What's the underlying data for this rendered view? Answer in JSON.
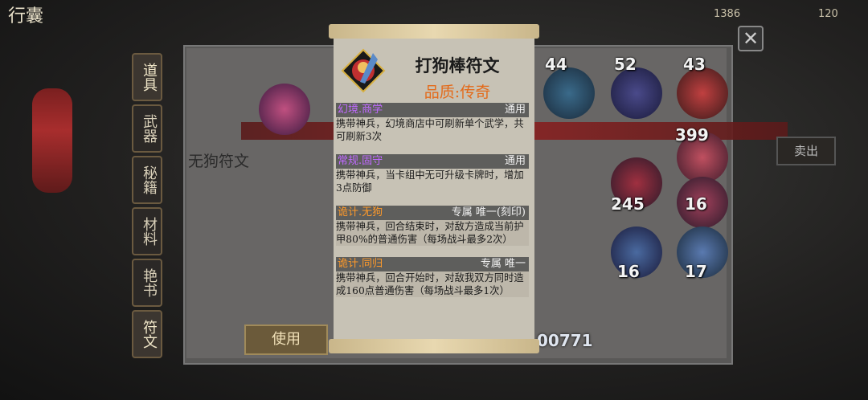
{
  "header": {
    "title": "行囊"
  },
  "currencies": [
    {
      "value": "1386"
    },
    {
      "value": "120"
    }
  ],
  "side_tabs": [
    {
      "label": "道具"
    },
    {
      "label": "武器"
    },
    {
      "label": "秘籍"
    },
    {
      "label": "材料"
    },
    {
      "label": "艳书"
    },
    {
      "label": "符文"
    }
  ],
  "detail": {
    "item_name": "无狗符文"
  },
  "buttons": {
    "use": "使用",
    "right": "卖出"
  },
  "grid_counts": [
    "44",
    "52",
    "43",
    "399",
    "245",
    "16",
    "16",
    "17",
    "00771"
  ],
  "popup": {
    "title": "打狗棒符文",
    "quality": "品质:传奇",
    "sections": [
      {
        "name": "幻境.商学",
        "tag": "通用",
        "name_color": "purple",
        "desc": "携带神兵，幻境商店中可刷新单个武学，共可刷新3次"
      },
      {
        "name": "常规.固守",
        "tag": "通用",
        "name_color": "purple",
        "desc": "携带神兵，当卡组中无可升级卡牌时，增加3点防御"
      },
      {
        "name": "诡计.无狗",
        "tag": "专属 唯一(刻印)",
        "name_color": "orange",
        "desc": "携带神兵，回合结束时，对敌方造成当前护甲80%的普通伤害（每场战斗最多2次）"
      },
      {
        "name": "诡计.同归",
        "tag": "专属 唯一",
        "name_color": "orange",
        "desc": "携带神兵，回合开始时，对敌我双方同时造成160点普通伤害（每场战斗最多1次）"
      }
    ]
  },
  "colors": {
    "quality": "#e36a1a",
    "purple": "#c06aff",
    "orange": "#ff9a2a"
  }
}
